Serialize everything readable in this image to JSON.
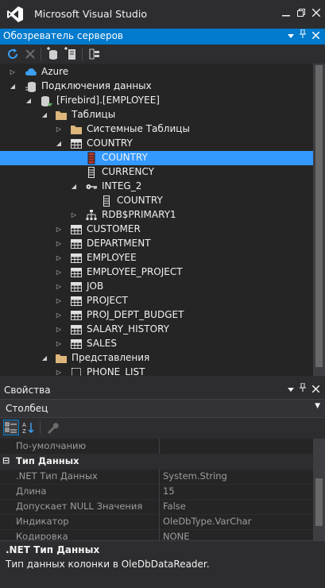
{
  "window": {
    "title": "Microsoft Visual Studio"
  },
  "server_explorer": {
    "title": "Обозреватель серверов",
    "tree": {
      "azure": "Azure",
      "data_connections": "Подключения данных",
      "connection": "[Firebird].[EMPLOYEE]",
      "tables": "Таблицы",
      "system_tables": "Системные Таблицы",
      "country": "COUNTRY",
      "col_country": "COUNTRY",
      "col_currency": "CURRENCY",
      "integ_2": "INTEG_2",
      "integ_2_country": "COUNTRY",
      "rdb_primary": "RDB$PRIMARY1",
      "customer": "CUSTOMER",
      "department": "DEPARTMENT",
      "employee": "EMPLOYEE",
      "employee_project": "EMPLOYEE_PROJECT",
      "job": "JOB",
      "project": "PROJECT",
      "proj_dept_budget": "PROJ_DEPT_BUDGET",
      "salary_history": "SALARY_HISTORY",
      "sales": "SALES",
      "views": "Представления",
      "phone_list": "PHONE_LIST"
    }
  },
  "properties": {
    "title": "Свойства",
    "selected_object": "Столбец",
    "rows": {
      "default": {
        "name": "По-умолчанию",
        "value": ""
      },
      "category": "Тип Данных",
      "net_type": {
        "name": ".NET Тип Данных",
        "value": "System.String"
      },
      "length": {
        "name": "Длина",
        "value": "15"
      },
      "allow_null": {
        "name": "Допускает NULL Значения",
        "value": "False"
      },
      "indicator": {
        "name": "Индикатор",
        "value": "OleDbType.VarChar"
      },
      "encoding": {
        "name": "Кодировка",
        "value": "NONE"
      }
    },
    "description": {
      "title": ".NET Тип Данных",
      "text": "Тип данных колонки в OleDbDataReader."
    }
  },
  "colors": {
    "accent": "#007acc",
    "selection": "#3399ff",
    "background": "#2d2d30",
    "tree_background": "#252526",
    "folder": "#dcb67a"
  }
}
